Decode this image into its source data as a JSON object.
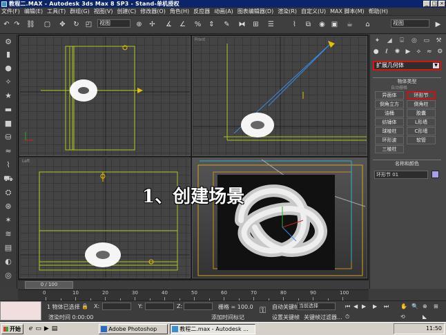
{
  "window": {
    "title": "教程二.MAX  - Autodesk 3ds Max 8 SP3  - Stand-单机授权"
  },
  "menu": [
    "文件(F)",
    "编辑(E)",
    "工具(T)",
    "群组(G)",
    "视图(V)",
    "创建(C)",
    "修改器(O)",
    "角色(H)",
    "反应器",
    "动画(A)",
    "图表编辑器(D)",
    "渲染(R)",
    "自定义(U)",
    "MAX 脚本(M)",
    "帮助(H)"
  ],
  "toolbar": {
    "ref_coord": "视图",
    "view_select": "视图"
  },
  "viewports": {
    "top_label": "",
    "front_label": "Front",
    "left_label": "Left",
    "persp_label": ""
  },
  "annotation": "1、创建场景",
  "command_panel": {
    "geometry_type": "扩展几何体",
    "object_type_header": "物体类型",
    "autogrid": "自动栅格",
    "buttons": [
      "异面体",
      "环形节",
      "倒角立方",
      "倒角柱",
      "油桶",
      "胶囊",
      "纺锤体",
      "L形墙",
      "球棱柱",
      "C形墙",
      "环形波",
      "软管",
      "三棱柱"
    ],
    "highlighted": "环形节",
    "name_color_header": "名称和颜色",
    "object_name": "环形节 01",
    "object_color": "#a8a0e8"
  },
  "timeline": {
    "frame_label": "0 / 100",
    "ticks": [
      "0",
      "10",
      "20",
      "30",
      "40",
      "50",
      "60",
      "70",
      "80",
      "90",
      "100"
    ]
  },
  "status": {
    "selection": "1 物体已选择",
    "render_time": "渲染时间 0:00:00",
    "x_label": "X:",
    "y_label": "Y:",
    "z_label": "Z:",
    "grid": "栅格 = 100.0",
    "add_time_tag": "添加时间标记",
    "auto_key": "自动关键帧",
    "set_key": "设置关键帧",
    "key_filter": "关键帧过滤器...",
    "selection_set": "选定对象",
    "current_select": "当前选择"
  },
  "taskbar": {
    "start": "开始",
    "items": [
      "Adobe Photoshop",
      "教程二.max - Autodesk ..."
    ],
    "clock": "11:50"
  }
}
